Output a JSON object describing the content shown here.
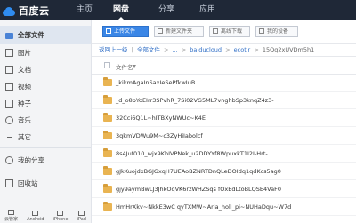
{
  "app": {
    "name": "百度云"
  },
  "nav": {
    "items": [
      "主页",
      "网盘",
      "分享",
      "应用"
    ],
    "active": "网盘"
  },
  "sidebar": {
    "items": [
      {
        "label": "全部文件",
        "icon": "folder-icon",
        "active": true
      },
      {
        "label": "图片",
        "icon": "image-icon"
      },
      {
        "label": "文档",
        "icon": "document-icon"
      },
      {
        "label": "视频",
        "icon": "video-icon"
      },
      {
        "label": "种子",
        "icon": "seed-icon"
      },
      {
        "label": "音乐",
        "icon": "music-icon"
      },
      {
        "label": "其它",
        "icon": "other-icon"
      },
      {
        "label": "我的分享",
        "icon": "share-icon"
      },
      {
        "label": "回收站",
        "icon": "trash-icon"
      }
    ],
    "devices": [
      "云管家",
      "Android",
      "iPhone",
      "iPad"
    ]
  },
  "toolbar": {
    "upload": "上传文件",
    "new_folder": "新建文件夹",
    "offline": "离线下载",
    "my_device": "我的设备"
  },
  "breadcrumb": {
    "back": "返回上一级",
    "all_files": "全部文件",
    "path": [
      "...",
      "baiducloud",
      "ecotir"
    ],
    "current": "15Qq2xUVDm5h1"
  },
  "list": {
    "header": "文件名",
    "files": [
      "_kikmAgaInSaxIeSePfkwIuB",
      "_d_o8pYoEIrr3SPvhR_7Si02VG5ML7vnghbSp3knqZ4z3-",
      "32Cci6Q1L~hITBXyNWUc~K4E",
      "3qkmVDWu9M~c3ZyHiIabolcf",
      "8s4Juf010_wjx9KhIVPNek_u2DDYYf8WpuxkT1I2I-Hrt-",
      "gJkKuojdxBGJGxqH7UEAoBZNRTDnQLeDOIdq1qdKcs5ag0",
      "gjy9aymBwLJ3JhkOqVK6rzWHZSqs fOxEdLtoBLQSE4VaF0",
      "HmHrXkv~NkkE3wC qyTXMW~Aria_holI_pi~NUHaDqu~W7d"
    ]
  }
}
